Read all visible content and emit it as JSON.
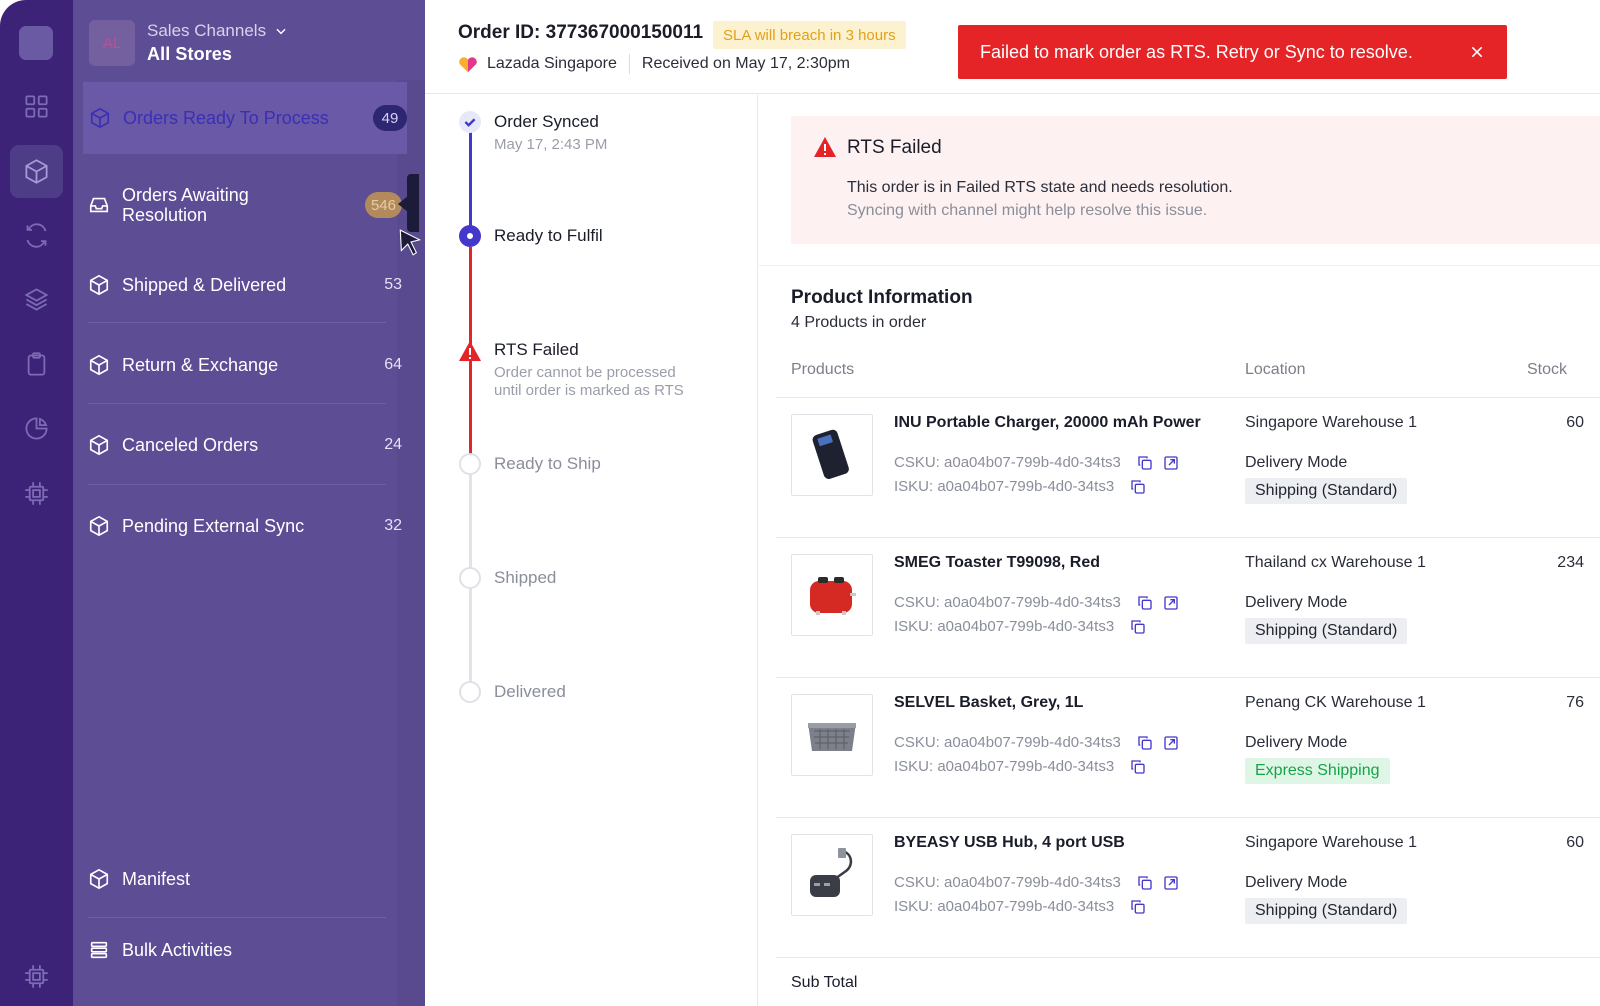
{
  "store": {
    "avatar": "AL",
    "label": "Sales Channels",
    "value": "All Stores"
  },
  "nav": {
    "items": [
      {
        "label": "Orders Ready To Process",
        "count": "49"
      },
      {
        "label": "Orders Awaiting Resolution",
        "count": "546"
      },
      {
        "label": "Shipped & Delivered",
        "count": "53"
      },
      {
        "label": "Return & Exchange",
        "count": "64"
      },
      {
        "label": "Canceled Orders",
        "count": "24"
      },
      {
        "label": "Pending External Sync",
        "count": "32"
      },
      {
        "label": "Manifest"
      },
      {
        "label": "Bulk Activities"
      }
    ]
  },
  "header": {
    "order_id": "Order ID: 377367000150011",
    "sla": "SLA will breach in 3 hours",
    "channel": "Lazada Singapore",
    "received": "Received on May 17, 2:30pm"
  },
  "toast": {
    "message": "Failed to mark order as RTS. Retry or Sync to resolve."
  },
  "timeline": [
    {
      "title": "Order Synced",
      "sub": "May 17, 2:43 PM",
      "state": "done"
    },
    {
      "title": "Ready to Fulfil",
      "sub": "",
      "state": "current"
    },
    {
      "title": "RTS Failed",
      "sub1": "Order cannot be processed",
      "sub2": "until order is marked as RTS",
      "state": "error"
    },
    {
      "title": "Ready to Ship",
      "state": "pending"
    },
    {
      "title": "Shipped",
      "state": "pending"
    },
    {
      "title": "Delivered",
      "state": "pending"
    }
  ],
  "alert": {
    "title": "RTS Failed",
    "line1": "This order is in Failed RTS state and needs resolution.",
    "line2": "Syncing with channel might help resolve this issue."
  },
  "products": {
    "title": "Product Information",
    "subtitle": "4 Products in order",
    "columns": {
      "products": "Products",
      "location": "Location",
      "stock": "Stock"
    },
    "delivery_mode_label": "Delivery Mode",
    "rows": [
      {
        "name": "INU Portable Charger, 20000 mAh Power",
        "csku": "CSKU: a0a04b07-799b-4d0-34ts3",
        "isku": "ISKU: a0a04b07-799b-4d0-34ts3",
        "location": "Singapore Warehouse 1",
        "shipping": "Shipping (Standard)",
        "stock": "60",
        "image": "power-bank"
      },
      {
        "name": "SMEG Toaster T99098, Red",
        "csku": "CSKU: a0a04b07-799b-4d0-34ts3",
        "isku": "ISKU: a0a04b07-799b-4d0-34ts3",
        "location": "Thailand cx Warehouse 1",
        "shipping": "Shipping (Standard)",
        "stock": "234",
        "image": "toaster"
      },
      {
        "name": "SELVEL Basket, Grey, 1L",
        "csku": "CSKU: a0a04b07-799b-4d0-34ts3",
        "isku": "ISKU: a0a04b07-799b-4d0-34ts3",
        "location": "Penang CK Warehouse 1",
        "shipping": "Express Shipping",
        "stock": "76",
        "image": "basket"
      },
      {
        "name": "BYEASY USB Hub, 4 port USB",
        "csku": "CSKU: a0a04b07-799b-4d0-34ts3",
        "isku": "ISKU: a0a04b07-799b-4d0-34ts3",
        "location": "Singapore Warehouse 1",
        "shipping": "Shipping (Standard)",
        "stock": "60",
        "image": "usb-hub"
      }
    ],
    "subtotal_label": "Sub Total"
  },
  "colors": {
    "rail": "#3d2377",
    "nav": "#5d4d95",
    "error": "#e42427",
    "accent": "#4338ca",
    "sla_bg": "#fdf2cf",
    "sla_text": "#e3a019",
    "express": "#16a34a"
  },
  "icons": {
    "rail": [
      "logo",
      "dashboard-icon",
      "box-icon",
      "sync-icon",
      "layers-icon",
      "clipboard-icon",
      "pie-chart-icon",
      "chip-icon"
    ],
    "row_actions": [
      "copy-icon",
      "external-link-icon"
    ]
  }
}
